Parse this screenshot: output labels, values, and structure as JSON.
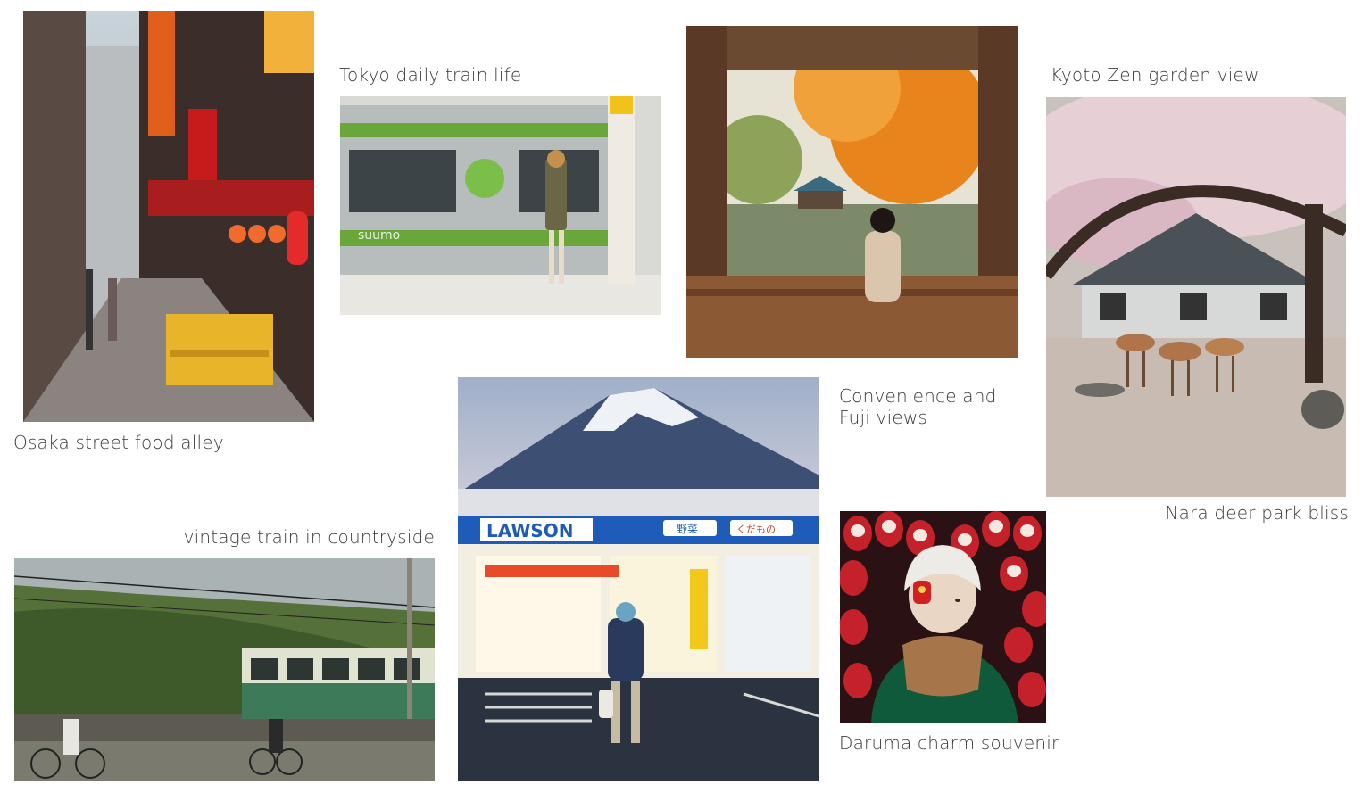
{
  "captions": {
    "osaka": "Osaka street food alley",
    "tokyo": "Tokyo daily train life",
    "convenience": "Convenience and Fuji views",
    "kyoto": "Kyoto Zen garden view",
    "nara": "Nara deer park bliss",
    "vintage": "vintage train in countryside",
    "daruma": "Daruma charm souvenir"
  },
  "sign_text": {
    "lawson": "LAWSON",
    "yasai": "野菜",
    "kudamono": "くだもの",
    "suumo": "suumo"
  }
}
